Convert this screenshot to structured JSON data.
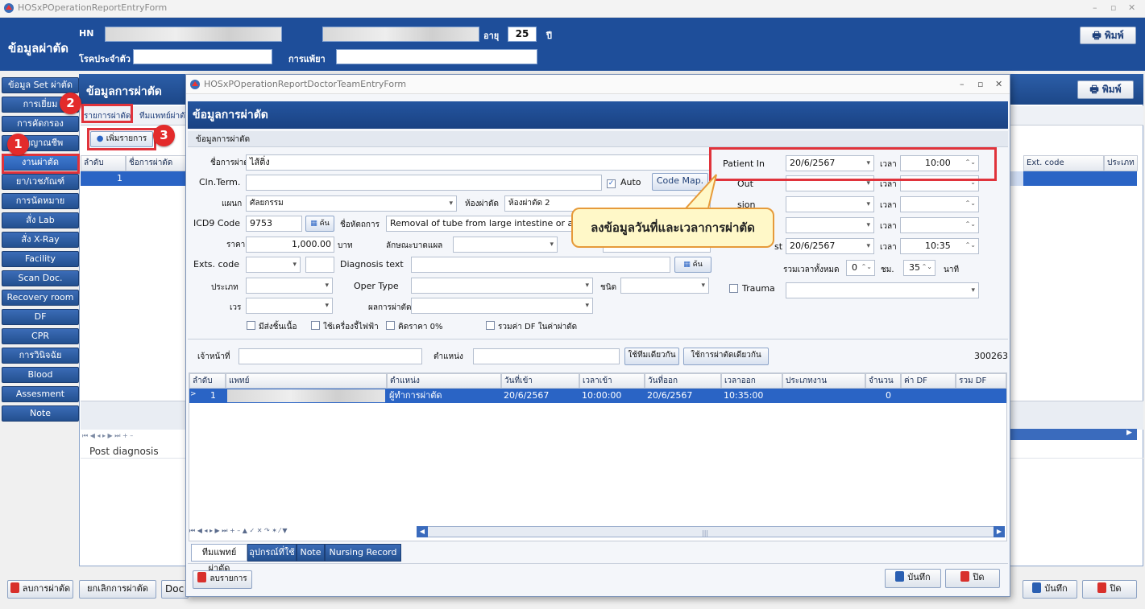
{
  "app": {
    "window_title": "HOSxPOperationReportEntryForm"
  },
  "header": {
    "title": "ข้อมูลผ่าตัด",
    "hn_label": "HN",
    "age_label": "อายุ",
    "age_value": "25",
    "age_unit": "ปี",
    "disease_label": "โรคประจำตัว",
    "allergy_label": "การแพ้ยา",
    "print_label": "พิมพ์"
  },
  "sidebar": {
    "items": [
      "ข้อมูล Set ผ่าตัด",
      "การเยี่ยม",
      "การคัดกรอง",
      "สัญญาณชีพ",
      "งานผ่าตัด",
      "ยา/เวชภัณฑ์",
      "การนัดหมาย",
      "สั่ง Lab",
      "สั่ง X-Ray",
      "Facility",
      "Scan Doc.",
      "Recovery room",
      "DF",
      "CPR",
      "การวินิจฉัย",
      "Blood",
      "Assesment",
      "Note"
    ]
  },
  "main": {
    "title": "ข้อมูลการผ่าตัด",
    "print_label": "พิมพ์",
    "tab_list": "รายการผ่าตัด",
    "tab_team": "ทีมแพทย์ผ่าตัด",
    "add_item": "เพิ่มรายการ",
    "col_no": "ลำดับ",
    "col_name": "ชื่อการผ่าตัด",
    "col_ext": "Ext. code",
    "col_type": "ประเภท",
    "row_no": "1",
    "post_dx": "Post diagnosis"
  },
  "dialog": {
    "window_title": "HOSxPOperationReportDoctorTeamEntryForm",
    "heading": "ข้อมูลการผ่าตัด",
    "section": "ข้อมูลการผ่าตัด",
    "op_name_label": "ชื่อการผ่าตัด",
    "op_name_value": "ไส้ติ่ง",
    "cln_label": "Cln.Term.",
    "auto_label": "Auto",
    "code_map": "Code Map.",
    "dept_label": "แผนก",
    "dept_value": "ศัลยกรรม",
    "room_label": "ห้องผ่าตัด",
    "room_value": "ห้องผ่าตัด 2",
    "icd9_label": "ICD9 Code",
    "icd9_value": "9753",
    "search": "ค้น",
    "proc_label": "ชื่อหัตถการ",
    "proc_value": "Removal of tube from large intestine or ap",
    "price_label": "ราคา",
    "price_value": "1,000.00",
    "baht": "บาท",
    "wound_label": "ลักษณะบาดแผล",
    "exts_label": "Exts. code",
    "dxtext_label": "Diagnosis text",
    "type_label": "ประเภท",
    "opertype_label": "Oper Type",
    "kind_label": "ชนิด",
    "shift_label": "เวร",
    "result_label": "ผลการผ่าตัด",
    "chk1": "มีส่งชิ้นเนื้อ",
    "chk2": "ใช้เครื่องจี้ไฟฟ้า",
    "chk3": "คิดราคา 0%",
    "chk4": "รวมค่า DF ในค่าผ่าตัด",
    "patient_in_label": "Patient In",
    "patient_in_date": "20/6/2567",
    "time_label": "เวลา",
    "patient_in_time": "10:00",
    "row2_label": "Out",
    "row3_label": "sion",
    "end_date": "20/6/2567",
    "end_time": "10:35",
    "end_label_tail": "st",
    "total_label": "รวมเวลาทั้งหมด",
    "total_hr": "0",
    "hr_unit": "ชม.",
    "total_min": "35",
    "min_unit": "นาที",
    "trauma_label": "Trauma",
    "staff_label": "เจ้าหน้าที่",
    "position_label": "ตำแหน่ง",
    "same_team": "ใช้ทีมเดียวกัน",
    "same_op": "ใช้การผ่าตัดเดียวกัน",
    "code_num": "300263",
    "grid": {
      "headers": [
        "ลำดับ",
        "แพทย์",
        "ตำแหน่ง",
        "วันที่เข้า",
        "เวลาเข้า",
        "วันที่ออก",
        "เวลาออก",
        "ประเภทงาน",
        "จำนวน",
        "ค่า DF",
        "รวม DF"
      ],
      "row": [
        "1",
        "",
        "ผู้ทำการผ่าตัด",
        "20/6/2567",
        "10:00:00",
        "20/6/2567",
        "10:35:00",
        "",
        "0",
        "",
        ""
      ]
    },
    "tabs": [
      "ทีมแพทย์ผ่าตัด",
      "อุปกรณ์ที่ใช้",
      "Note",
      "Nursing Record"
    ],
    "delete_item": "ลบรายการ",
    "save": "บันทึก",
    "close": "ปิด"
  },
  "callout": "ลงข้อมูลวันที่และเวลาการผ่าตัด",
  "badges": [
    "1",
    "2",
    "3"
  ],
  "footer": {
    "delete_op": "ลบการผ่าตัด",
    "cancel_op": "ยกเลิกการผ่าตัด",
    "doc": "Doc",
    "save": "บันทึก",
    "close": "ปิด"
  }
}
